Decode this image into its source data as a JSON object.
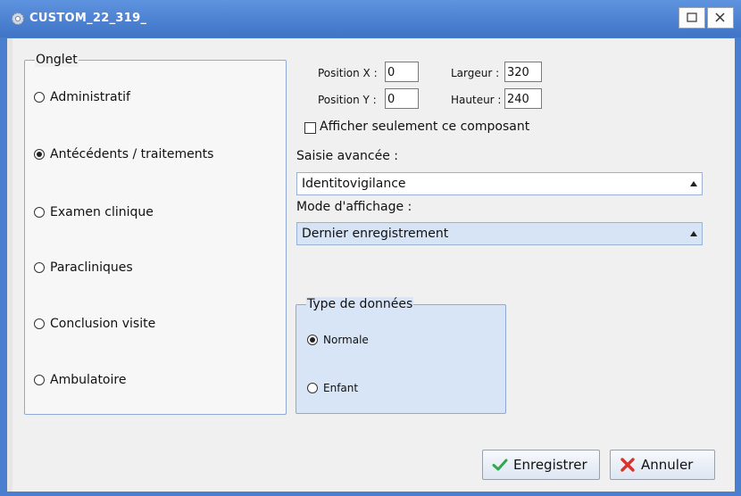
{
  "window": {
    "title": "CUSTOM_22_319_",
    "icon": "gear-icon"
  },
  "onglet": {
    "legend": "Onglet",
    "selected": "Antécédents / traitements",
    "items": [
      {
        "label": "Administratif",
        "checked": false
      },
      {
        "label": "Antécédents / traitements",
        "checked": true
      },
      {
        "label": "Examen clinique",
        "checked": false
      },
      {
        "label": "Paracliniques",
        "checked": false
      },
      {
        "label": "Conclusion visite",
        "checked": false
      },
      {
        "label": "Ambulatoire",
        "checked": false
      }
    ]
  },
  "position": {
    "x_label": "Position X :",
    "x_value": "0",
    "y_label": "Position Y :",
    "y_value": "0",
    "width_label": "Largeur :",
    "width_value": "320",
    "height_label": "Hauteur :",
    "height_value": "240"
  },
  "only_component": {
    "label": "Afficher seulement ce composant",
    "checked": false
  },
  "advanced": {
    "label": "Saisie avancée :",
    "value": "Identitovigilance"
  },
  "display_mode": {
    "label": "Mode d'affichage :",
    "value": "Dernier enregistrement"
  },
  "data_type": {
    "legend": "Type de données",
    "options": [
      {
        "label": "Normale",
        "checked": true
      },
      {
        "label": "Enfant",
        "checked": false
      }
    ]
  },
  "buttons": {
    "save": "Enregistrer",
    "cancel": "Annuler"
  },
  "colors": {
    "titlebar": "#4a7fd0",
    "panel": "#d7e5f7",
    "save_icon": "#2fa84f",
    "cancel_icon": "#d9342b"
  }
}
